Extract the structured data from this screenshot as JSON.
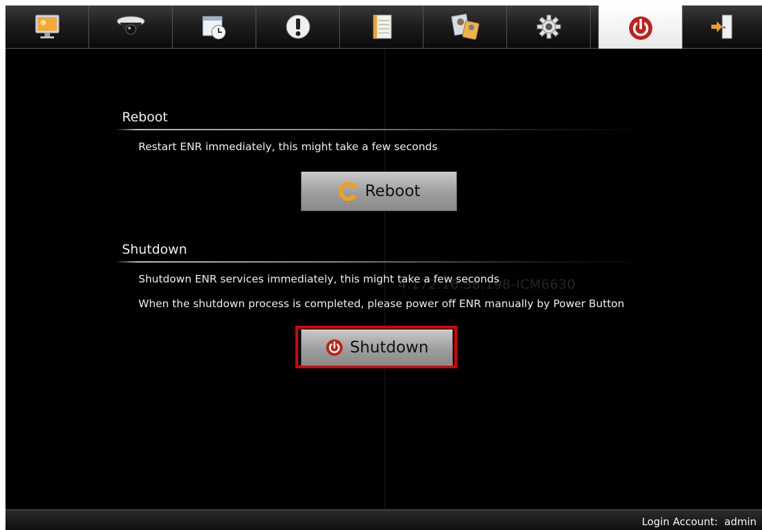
{
  "toolbar": {
    "tabs": [
      {
        "name": "monitor-icon"
      },
      {
        "name": "dome-camera-icon"
      },
      {
        "name": "schedule-icon"
      },
      {
        "name": "alert-icon"
      },
      {
        "name": "log-icon"
      },
      {
        "name": "user-account-icon"
      },
      {
        "name": "gear-icon"
      },
      {
        "name": "power-icon",
        "active": true
      },
      {
        "name": "logout-icon"
      }
    ]
  },
  "reboot": {
    "title": "Reboot",
    "description": "Restart ENR immediately, this might take a few seconds",
    "button_label": "Reboot"
  },
  "shutdown": {
    "title": "Shutdown",
    "description_1": "Shutdown ENR services immediately, this might take a few seconds",
    "description_2": "When the shutdown process is completed, please power off ENR manually by Power Button",
    "button_label": "Shutdown"
  },
  "watermark": "4.172.16.38.198-ICM6630",
  "status": {
    "login_label": "Login Account:",
    "login_user": "admin"
  },
  "colors": {
    "background": "#000000",
    "accent_red": "#c0201a",
    "highlight": "#e00000",
    "reboot_icon": "#f0a020"
  }
}
